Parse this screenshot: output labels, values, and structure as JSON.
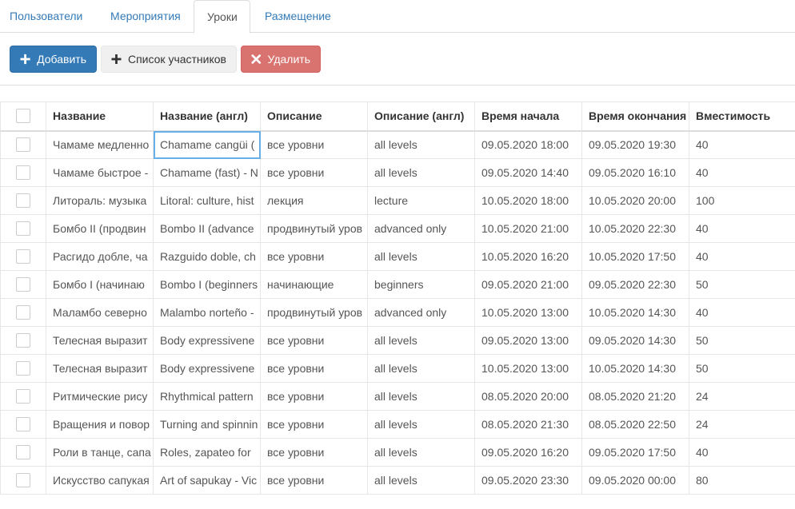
{
  "tabs": [
    {
      "label": "Пользователи"
    },
    {
      "label": "Мероприятия"
    },
    {
      "label": "Уроки"
    },
    {
      "label": "Размещение"
    }
  ],
  "toolbar": {
    "add_label": "Добавить",
    "participants_label": "Список участников",
    "delete_label": "Удалить"
  },
  "colors": {
    "primary": "#337ab7",
    "danger": "#d9736f",
    "link": "#337ab7"
  },
  "table": {
    "headers": [
      "Название",
      "Название (англ)",
      "Описание",
      "Описание (англ)",
      "Время начала",
      "Время окончания",
      "Вместимость"
    ],
    "rows": [
      [
        "Чамаме медленно",
        "Chamame cangüi (",
        "все уровни",
        "all levels",
        "09.05.2020 18:00",
        "09.05.2020 19:30",
        "40"
      ],
      [
        "Чамаме быстрое -",
        "Chamame (fast) - N",
        "все уровни",
        "all levels",
        "09.05.2020 14:40",
        "09.05.2020 16:10",
        "40"
      ],
      [
        "Литораль: музыка",
        "Litoral: culture, hist",
        "лекция",
        "lecture",
        "10.05.2020 18:00",
        "10.05.2020 20:00",
        "100"
      ],
      [
        "Бомбо II (продвин",
        "Bombo II (advance",
        "продвинутый уров",
        "advanced only",
        "10.05.2020 21:00",
        "10.05.2020 22:30",
        "40"
      ],
      [
        "Расгидо добле, ча",
        "Razguido doble, ch",
        "все уровни",
        "all levels",
        "10.05.2020 16:20",
        "10.05.2020 17:50",
        "40"
      ],
      [
        "Бомбо I (начинаю",
        "Bombo I (beginners",
        "начинающие",
        "beginners",
        "09.05.2020 21:00",
        "09.05.2020 22:30",
        "50"
      ],
      [
        "Маламбо северно",
        "Malambo norteño -",
        "продвинутый уров",
        "advanced only",
        "10.05.2020 13:00",
        "10.05.2020 14:30",
        "40"
      ],
      [
        "Телесная выразит",
        "Body expressivene",
        "все уровни",
        "all levels",
        "09.05.2020 13:00",
        "09.05.2020 14:30",
        "50"
      ],
      [
        "Телесная выразит",
        "Body expressivene",
        "все уровни",
        "all levels",
        "10.05.2020 13:00",
        "10.05.2020 14:30",
        "50"
      ],
      [
        "Ритмические рису",
        "Rhythmical pattern",
        "все уровни",
        "all levels",
        "08.05.2020 20:00",
        "08.05.2020 21:20",
        "24"
      ],
      [
        "Вращения и повор",
        "Turning and spinnin",
        "все уровни",
        "all levels",
        "08.05.2020 21:30",
        "08.05.2020 22:50",
        "24"
      ],
      [
        "Роли в танце, сапа",
        "Roles, zapateo for",
        "все уровни",
        "all levels",
        "09.05.2020 16:20",
        "09.05.2020 17:50",
        "40"
      ],
      [
        "Искусство сапукая",
        "Art of sapukay - Vic",
        "все уровни",
        "all levels",
        "09.05.2020 23:30",
        "09.05.2020 00:00",
        "80"
      ]
    ]
  }
}
